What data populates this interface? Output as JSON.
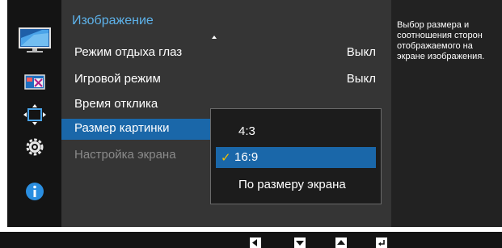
{
  "menu": {
    "title": "Изображение",
    "items": [
      {
        "label": "Режим отдыха глаз",
        "value": "Выкл"
      },
      {
        "label": "Игровой режим",
        "value": "Выкл"
      },
      {
        "label": "Время отклика",
        "value": ""
      },
      {
        "label": "Размер картинки",
        "value": ""
      },
      {
        "label": "Настройка экрана",
        "value": ""
      }
    ]
  },
  "submenu": {
    "options": [
      "4:3",
      "16:9",
      "По размеру экрана"
    ],
    "selected": "16:9",
    "check_symbol": "✓"
  },
  "help": {
    "text": "Выбор размера и соотношения сторон отображаемого на экране изображения."
  },
  "icons": {
    "sidebar": [
      "picture-icon",
      "color-icon",
      "screen-size-icon",
      "settings-icon",
      "info-icon"
    ],
    "bottom": [
      "left-arrow-icon",
      "down-arrow-icon",
      "up-arrow-icon",
      "enter-icon"
    ]
  },
  "colors": {
    "title": "#5db2ea",
    "highlight": "#1a67a9",
    "check": "#f5c200",
    "info_icon": "#2a8ee0"
  }
}
